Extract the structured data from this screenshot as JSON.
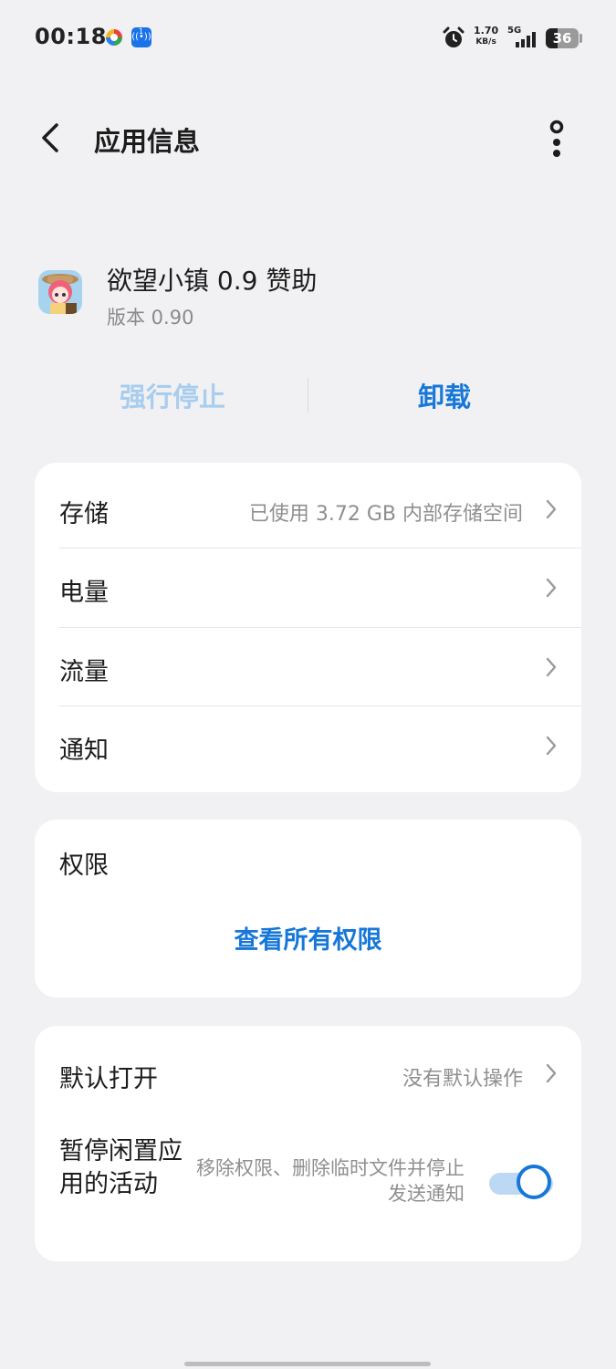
{
  "status_bar": {
    "time": "00:18",
    "network_speed_value": "1.70",
    "network_speed_unit": "KB/s",
    "network_type": "5G",
    "battery_level": "36",
    "notification_badge": "1",
    "icons": [
      "colorful-app-icon",
      "broadcast-icon",
      "alarm-icon",
      "signal-icon",
      "battery-icon"
    ]
  },
  "header": {
    "title": "应用信息",
    "back_icon": "chevron-left-icon",
    "more_icon": "more-vertical-icon"
  },
  "app": {
    "name": "欲望小镇 0.9 赞助",
    "version": "版本 0.90"
  },
  "actions": {
    "force_stop": "强行停止",
    "uninstall": "卸载"
  },
  "settings": [
    {
      "label": "存储",
      "value": "已使用 3.72 GB 内部存储空间"
    },
    {
      "label": "电量",
      "value": ""
    },
    {
      "label": "流量",
      "value": ""
    },
    {
      "label": "通知",
      "value": ""
    }
  ],
  "permissions": {
    "title": "权限",
    "link": "查看所有权限"
  },
  "defaults": {
    "label": "默认打开",
    "value": "没有默认操作"
  },
  "pause_activity": {
    "label": "暂停闲置应用的活动",
    "description": "移除权限、删除临时文件并停止发送通知",
    "enabled": true
  },
  "colors": {
    "accent": "#1677d8",
    "disabled_accent": "#a9cdee",
    "background": "#f1f1f3",
    "card": "#ffffff"
  }
}
